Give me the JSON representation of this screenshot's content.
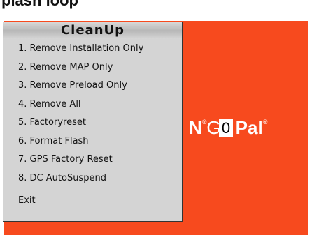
{
  "page": {
    "title": "plash loop"
  },
  "background": {
    "color": "#f74a1e"
  },
  "logo": {
    "part_a": "N",
    "mark_a": "®",
    "part_b": "G",
    "part_c": "Pal",
    "mark_c": "®"
  },
  "cursor": {
    "glyph": "0"
  },
  "menu": {
    "title": "CleanUp",
    "items": [
      {
        "label": "1. Remove Installation Only"
      },
      {
        "label": "2. Remove MAP Only"
      },
      {
        "label": "3. Remove Preload Only"
      },
      {
        "label": "4. Remove All"
      },
      {
        "label": "5. Factoryreset"
      },
      {
        "label": "6. Format Flash"
      },
      {
        "label": "7. GPS Factory Reset"
      },
      {
        "label": "8. DC AutoSuspend"
      }
    ],
    "exit_label": "Exit"
  }
}
